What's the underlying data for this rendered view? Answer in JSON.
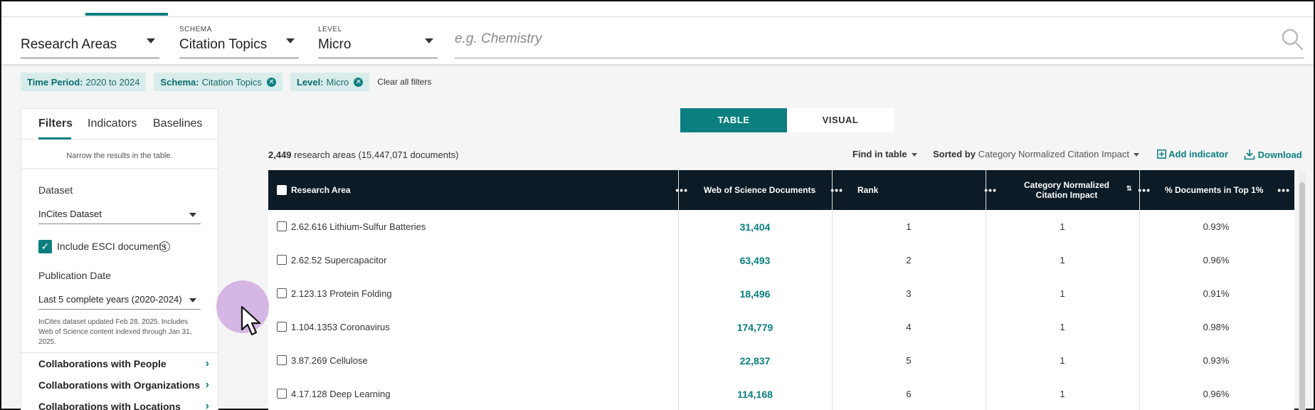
{
  "selector": {
    "research_areas": {
      "caption": "",
      "value": "Research Areas"
    },
    "schema": {
      "caption": "SCHEMA",
      "value": "Citation Topics"
    },
    "level": {
      "caption": "LEVEL",
      "value": "Micro"
    },
    "search": {
      "placeholder": "e.g. Chemistry",
      "value": ""
    }
  },
  "filters_applied": [
    {
      "label": "Time Period:",
      "value": "2020 to 2024",
      "removable": false
    },
    {
      "label": "Schema:",
      "value": "Citation Topics",
      "removable": true
    },
    {
      "label": "Level:",
      "value": "Micro",
      "removable": true
    }
  ],
  "clear_all_label": "Clear all filters",
  "left_panel": {
    "tabs": [
      "Filters",
      "Indicators",
      "Baselines"
    ],
    "active_tab": "Filters",
    "helper": "Narrow the results in the table.",
    "dataset_label": "Dataset",
    "dataset_value": "InCites Dataset",
    "include_esci_label": "Include ESCI documents",
    "include_esci_checked": true,
    "publication_date_label": "Publication Date",
    "publication_date_value": "Last 5 complete years (2020-2024)",
    "note": "InCites dataset updated Feb 28, 2025. Includes Web of Science content indexed through Jan 31, 2025.",
    "sections": [
      "Collaborations with People",
      "Collaborations with Organizations",
      "Collaborations with Locations"
    ]
  },
  "view_toggle": {
    "table": "TABLE",
    "visual": "VISUAL",
    "active": "TABLE"
  },
  "summary": {
    "count": "2,449",
    "text": "research areas (15,447,071 documents)"
  },
  "toolbar": {
    "find_in_table": "Find in table",
    "sorted_by_label": "Sorted by",
    "sorted_by_value": "Category Normalized Citation Impact",
    "add_indicator": "Add indicator",
    "download": "Download"
  },
  "table": {
    "columns": [
      "Research Area",
      "Web of Science Documents",
      "Rank",
      "Category Normalized Citation Impact",
      "% Documents in Top 1%"
    ],
    "rows": [
      {
        "area": "2.62.616 Lithium-Sulfur Batteries",
        "docs": "31,404",
        "rank": "1",
        "cnci": "1",
        "top1": "0.93%"
      },
      {
        "area": "2.62.52 Supercapacitor",
        "docs": "63,493",
        "rank": "2",
        "cnci": "1",
        "top1": "0.96%"
      },
      {
        "area": "2.123.13 Protein Folding",
        "docs": "18,496",
        "rank": "3",
        "cnci": "1",
        "top1": "0.91%"
      },
      {
        "area": "1.104.1353 Coronavirus",
        "docs": "174,779",
        "rank": "4",
        "cnci": "1",
        "top1": "0.98%"
      },
      {
        "area": "3.87.269 Cellulose",
        "docs": "22,837",
        "rank": "5",
        "cnci": "1",
        "top1": "0.93%"
      },
      {
        "area": "4.17.128 Deep Learning",
        "docs": "114,168",
        "rank": "6",
        "cnci": "1",
        "top1": "0.96%"
      }
    ]
  },
  "colors": {
    "accent": "#0b7f80",
    "header_bg": "#0c1b25",
    "chip_bg": "#d9ecec"
  }
}
